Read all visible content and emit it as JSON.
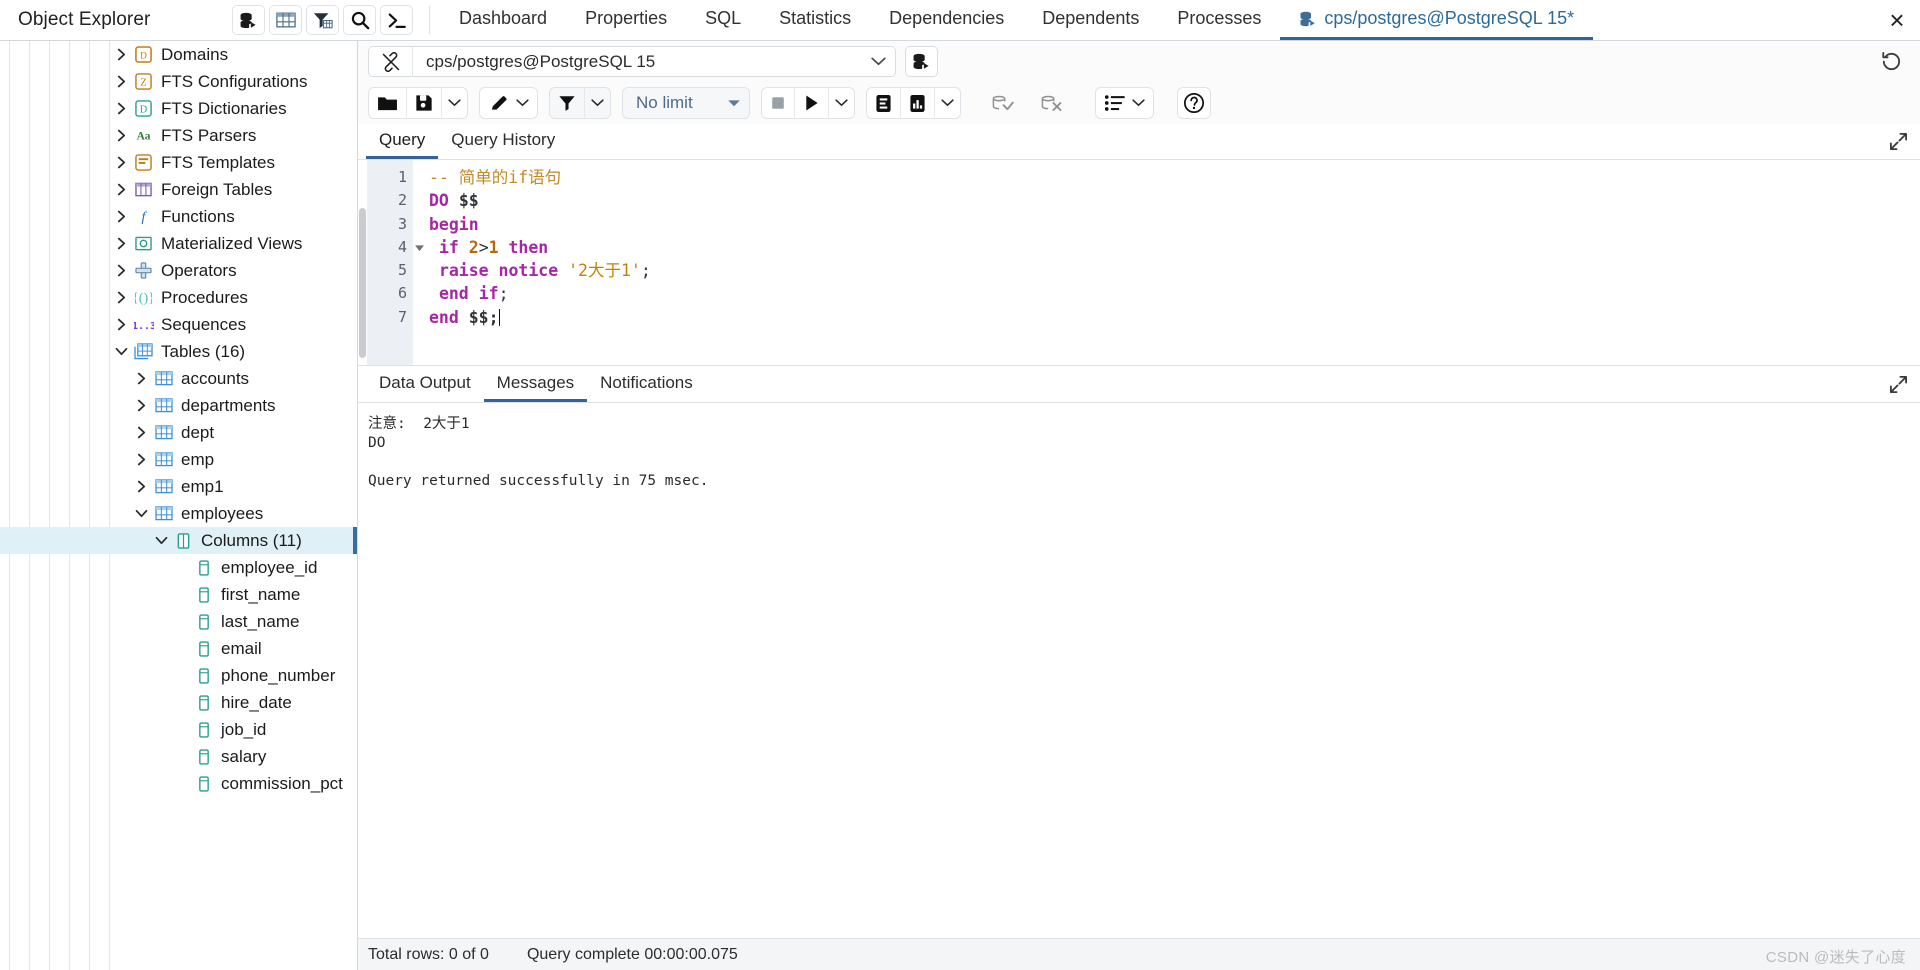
{
  "topbar": {
    "object_explorer_title": "Object Explorer",
    "tools": [
      {
        "name": "filtered-rows-icon",
        "label": ""
      },
      {
        "name": "table-grid-icon",
        "label": ""
      },
      {
        "name": "filter-table-icon",
        "label": ""
      },
      {
        "name": "search-icon",
        "label": ""
      },
      {
        "name": "terminal-icon",
        "label": ""
      }
    ],
    "tabs": [
      {
        "label": "Dashboard",
        "active": false,
        "icon": null
      },
      {
        "label": "Properties",
        "active": false,
        "icon": null
      },
      {
        "label": "SQL",
        "active": false,
        "icon": null
      },
      {
        "label": "Statistics",
        "active": false,
        "icon": null
      },
      {
        "label": "Dependencies",
        "active": false,
        "icon": null
      },
      {
        "label": "Dependents",
        "active": false,
        "icon": null
      },
      {
        "label": "Processes",
        "active": false,
        "icon": null
      },
      {
        "label": "cps/postgres@PostgreSQL 15*",
        "active": true,
        "icon": "database-query-icon"
      }
    ],
    "close_label": "×"
  },
  "sidebar": {
    "nodes": [
      {
        "label": "Domains",
        "indent": 0,
        "twisty": "collapsed",
        "icon": "domain-icon",
        "selected": false
      },
      {
        "label": "FTS Configurations",
        "indent": 0,
        "twisty": "collapsed",
        "icon": "fts-config-icon",
        "selected": false
      },
      {
        "label": "FTS Dictionaries",
        "indent": 0,
        "twisty": "collapsed",
        "icon": "fts-dict-icon",
        "selected": false
      },
      {
        "label": "FTS Parsers",
        "indent": 0,
        "twisty": "collapsed",
        "icon": "fts-parser-icon",
        "selected": false
      },
      {
        "label": "FTS Templates",
        "indent": 0,
        "twisty": "collapsed",
        "icon": "fts-template-icon",
        "selected": false
      },
      {
        "label": "Foreign Tables",
        "indent": 0,
        "twisty": "collapsed",
        "icon": "foreign-table-icon",
        "selected": false
      },
      {
        "label": "Functions",
        "indent": 0,
        "twisty": "collapsed",
        "icon": "function-icon",
        "selected": false
      },
      {
        "label": "Materialized Views",
        "indent": 0,
        "twisty": "collapsed",
        "icon": "mat-view-icon",
        "selected": false
      },
      {
        "label": "Operators",
        "indent": 0,
        "twisty": "collapsed",
        "icon": "operator-icon",
        "selected": false
      },
      {
        "label": "Procedures",
        "indent": 0,
        "twisty": "collapsed",
        "icon": "procedure-icon",
        "selected": false
      },
      {
        "label": "Sequences",
        "indent": 0,
        "twisty": "collapsed",
        "icon": "sequence-icon",
        "selected": false
      },
      {
        "label": "Tables (16)",
        "indent": 0,
        "twisty": "expanded",
        "icon": "tables-icon",
        "selected": false
      },
      {
        "label": "accounts",
        "indent": 1,
        "twisty": "collapsed",
        "icon": "table-icon",
        "selected": false
      },
      {
        "label": "departments",
        "indent": 1,
        "twisty": "collapsed",
        "icon": "table-icon",
        "selected": false
      },
      {
        "label": "dept",
        "indent": 1,
        "twisty": "collapsed",
        "icon": "table-icon",
        "selected": false
      },
      {
        "label": "emp",
        "indent": 1,
        "twisty": "collapsed",
        "icon": "table-icon",
        "selected": false
      },
      {
        "label": "emp1",
        "indent": 1,
        "twisty": "collapsed",
        "icon": "table-icon",
        "selected": false
      },
      {
        "label": "employees",
        "indent": 1,
        "twisty": "expanded",
        "icon": "table-icon",
        "selected": false
      },
      {
        "label": "Columns (11)",
        "indent": 2,
        "twisty": "expanded",
        "icon": "columns-icon",
        "selected": true
      },
      {
        "label": "employee_id",
        "indent": 3,
        "twisty": "none",
        "icon": "column-icon",
        "selected": false
      },
      {
        "label": "first_name",
        "indent": 3,
        "twisty": "none",
        "icon": "column-icon",
        "selected": false
      },
      {
        "label": "last_name",
        "indent": 3,
        "twisty": "none",
        "icon": "column-icon",
        "selected": false
      },
      {
        "label": "email",
        "indent": 3,
        "twisty": "none",
        "icon": "column-icon",
        "selected": false
      },
      {
        "label": "phone_number",
        "indent": 3,
        "twisty": "none",
        "icon": "column-icon",
        "selected": false
      },
      {
        "label": "hire_date",
        "indent": 3,
        "twisty": "none",
        "icon": "column-icon",
        "selected": false
      },
      {
        "label": "job_id",
        "indent": 3,
        "twisty": "none",
        "icon": "column-icon",
        "selected": false
      },
      {
        "label": "salary",
        "indent": 3,
        "twisty": "none",
        "icon": "column-icon",
        "selected": false
      },
      {
        "label": "commission_pct",
        "indent": 3,
        "twisty": "none",
        "icon": "column-icon",
        "selected": false
      }
    ]
  },
  "connection": {
    "value": "cps/postgres@PostgreSQL 15",
    "icon": "disconnected-icon",
    "extra_icon": "database-query-icon",
    "restore_icon": "restore-history-icon"
  },
  "query_toolbar": {
    "open_file": "open-file-icon",
    "save_file": "save-file-icon",
    "save_caret": "chevron-down-icon",
    "edit": "pencil-icon",
    "edit_caret": "chevron-down-icon",
    "filter": "filter-icon",
    "filter_caret": "chevron-down-icon",
    "row_limit_label": "No limit",
    "row_limit_caret": "chevron-down-icon",
    "stop": "stop-icon",
    "execute": "play-icon",
    "execute_caret": "chevron-down-icon",
    "explain": "explain-icon",
    "explain_analyze": "explain-analyze-icon",
    "explain_caret": "chevron-down-icon",
    "commit": "commit-icon",
    "rollback": "rollback-icon",
    "macros": "macros-icon",
    "macros_caret": "chevron-down-icon",
    "help": "help-icon"
  },
  "editor": {
    "tabs": [
      {
        "label": "Query",
        "active": true
      },
      {
        "label": "Query History",
        "active": false
      }
    ],
    "expand_icon": "expand-icon",
    "lines": [
      {
        "n": "1",
        "fold": false,
        "tokens": [
          {
            "t": "-- 简单的if语句",
            "c": "cm"
          }
        ]
      },
      {
        "n": "2",
        "fold": false,
        "tokens": [
          {
            "t": "DO",
            "c": "kw"
          },
          {
            "t": " ",
            "c": "op"
          },
          {
            "t": "$$",
            "c": "dollar"
          }
        ]
      },
      {
        "n": "3",
        "fold": false,
        "tokens": [
          {
            "t": "begin",
            "c": "kw"
          }
        ]
      },
      {
        "n": "4",
        "fold": true,
        "tokens": [
          {
            "t": " ",
            "c": "op"
          },
          {
            "t": "if",
            "c": "kw"
          },
          {
            "t": " ",
            "c": "op"
          },
          {
            "t": "2",
            "c": "num"
          },
          {
            "t": ">",
            "c": "op"
          },
          {
            "t": "1",
            "c": "num"
          },
          {
            "t": " ",
            "c": "op"
          },
          {
            "t": "then",
            "c": "kw"
          }
        ]
      },
      {
        "n": "5",
        "fold": false,
        "tokens": [
          {
            "t": " ",
            "c": "op"
          },
          {
            "t": "raise",
            "c": "kw"
          },
          {
            "t": " ",
            "c": "op"
          },
          {
            "t": "notice",
            "c": "kw"
          },
          {
            "t": " ",
            "c": "op"
          },
          {
            "t": "'2大于1'",
            "c": "str"
          },
          {
            "t": ";",
            "c": "op"
          }
        ]
      },
      {
        "n": "6",
        "fold": false,
        "tokens": [
          {
            "t": " ",
            "c": "op"
          },
          {
            "t": "end",
            "c": "kw"
          },
          {
            "t": " ",
            "c": "op"
          },
          {
            "t": "if",
            "c": "kw"
          },
          {
            "t": ";",
            "c": "op"
          }
        ]
      },
      {
        "n": "7",
        "fold": false,
        "tokens": [
          {
            "t": "end",
            "c": "kw"
          },
          {
            "t": " ",
            "c": "op"
          },
          {
            "t": "$$;",
            "c": "dollar"
          }
        ],
        "caret": true
      }
    ]
  },
  "output": {
    "tabs": [
      {
        "label": "Data Output",
        "active": false
      },
      {
        "label": "Messages",
        "active": true
      },
      {
        "label": "Notifications",
        "active": false
      }
    ],
    "expand_icon": "expand-icon",
    "messages": [
      "注意:  2大于1",
      "DO",
      "",
      "Query returned successfully in 75 msec."
    ]
  },
  "statusbar": {
    "total_rows": "Total rows: 0 of 0",
    "query_complete": "Query complete 00:00:00.075",
    "watermark": "CSDN @迷失了心度"
  },
  "colors": {
    "accent": "#32649a",
    "selection": "#dff0f6",
    "keyword": "#a626a4",
    "comment": "#c08a27",
    "string": "#c18401",
    "number": "#b36b12",
    "table_icon": "#3e8ede"
  }
}
